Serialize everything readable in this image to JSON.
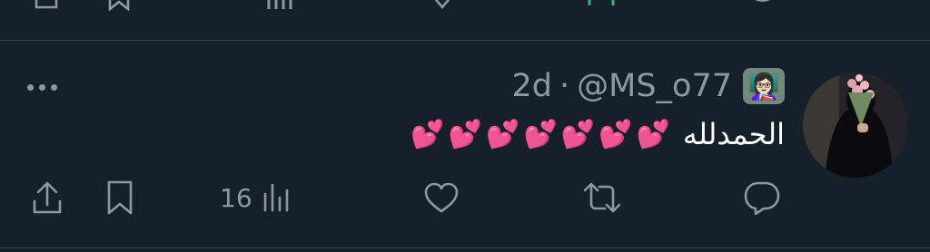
{
  "previous_tweet": {
    "actions": [
      "share",
      "bookmark",
      "views",
      "like",
      "retweet",
      "reply"
    ]
  },
  "tweet": {
    "time": "2d",
    "separator": "·",
    "handle": "@MS_o77",
    "badge_emoji": "👩🏻‍🏫",
    "text": "الحمدلله",
    "hearts": "💕💕💕💕💕💕💕",
    "views_count": "16",
    "icons": [
      "more-icon",
      "share-icon",
      "bookmark-icon",
      "views-icon",
      "like-icon",
      "retweet-icon",
      "reply-icon"
    ]
  },
  "colors": {
    "background": "#15202b",
    "divider": "#38444d",
    "muted": "#8b98a5",
    "text": "#ffffff",
    "hearts": "#f14fb3"
  }
}
